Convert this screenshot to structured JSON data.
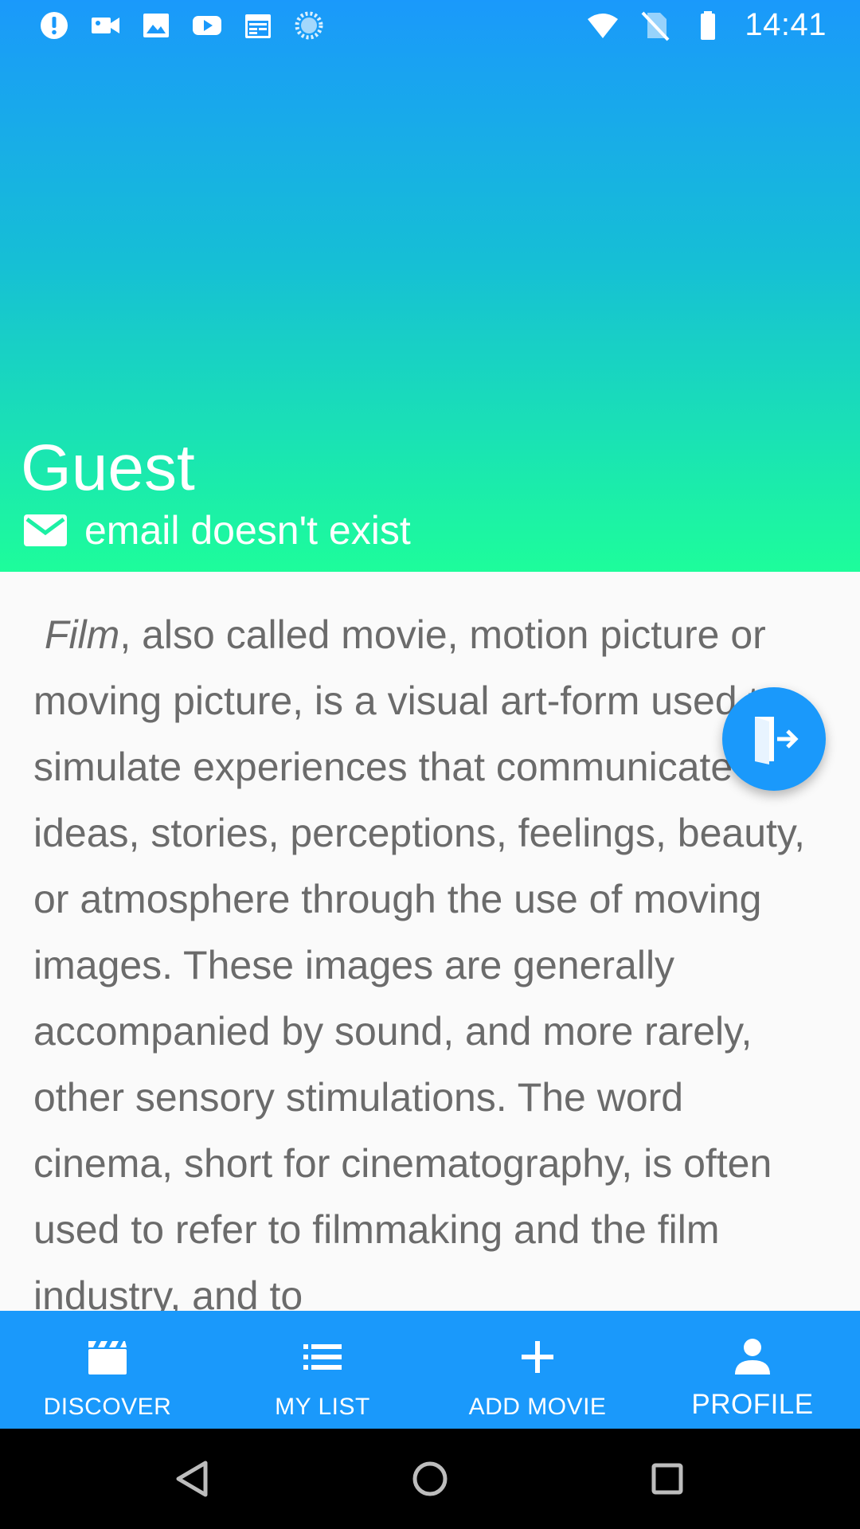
{
  "status_bar": {
    "time": "14:41",
    "left_icons": [
      "alert-icon",
      "video-camera-icon",
      "image-icon",
      "youtube-icon",
      "calendar-icon",
      "loading-icon"
    ],
    "right_icons": [
      "wifi-icon",
      "no-sim-icon",
      "battery-icon"
    ]
  },
  "profile": {
    "name": "Guest",
    "email": "email doesn't exist"
  },
  "description": {
    "lead_italic": "Film",
    "body": ", also called movie, motion picture or moving picture, is a visual art-form used to simulate experiences that communicate ideas, stories, perceptions, feelings, beauty, or atmosphere through the use of moving images. These images are generally accompanied by sound, and more rarely, other sensory stimulations. The word cinema, short for cinematography, is often used to refer to filmmaking and the film industry, and to"
  },
  "fab": {
    "icon": "logout-icon"
  },
  "bottom_nav": {
    "items": [
      {
        "label": "DISCOVER",
        "icon": "clapperboard-icon"
      },
      {
        "label": "MY LIST",
        "icon": "list-icon"
      },
      {
        "label": "ADD MOVIE",
        "icon": "plus-icon"
      },
      {
        "label": "PROFILE",
        "icon": "person-icon"
      }
    ],
    "active_label": "PROFILE"
  },
  "colors": {
    "primary": "#1a99fb",
    "gradient_end": "#1dfd9b",
    "text_body": "#6b6b6b"
  }
}
